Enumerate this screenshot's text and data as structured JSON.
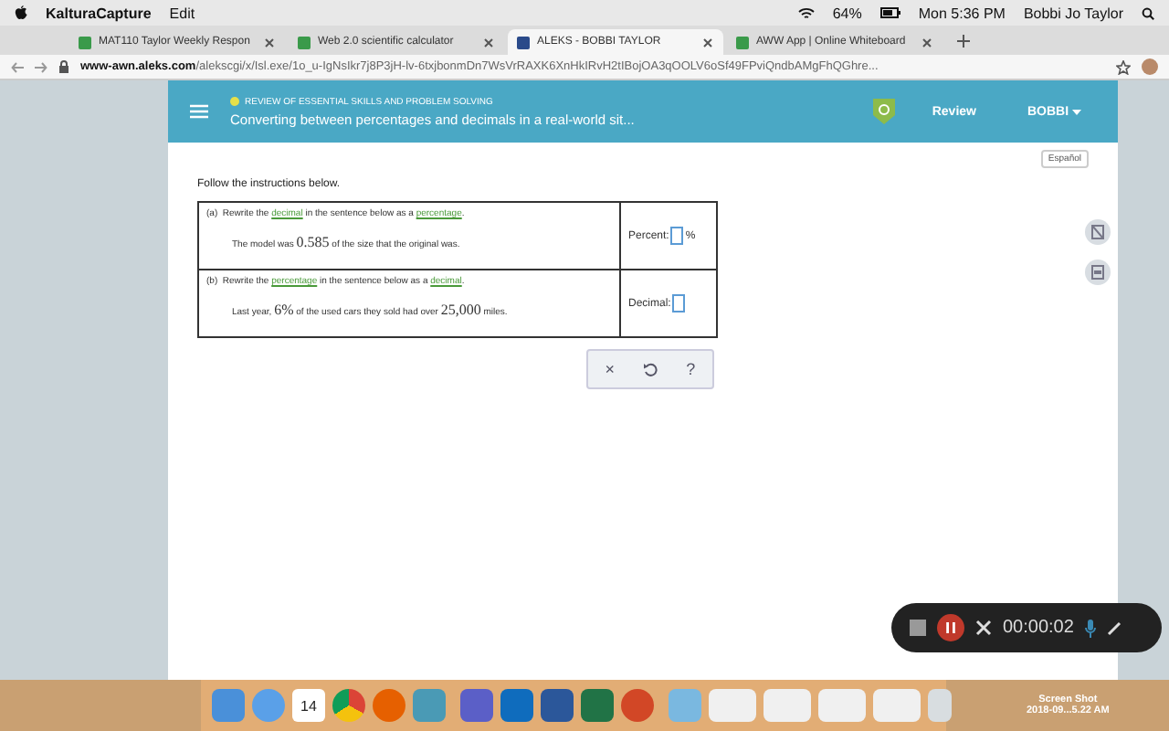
{
  "menubar": {
    "app": "KalturaCapture",
    "menus": [
      "Edit"
    ],
    "battery": "64%",
    "clock": "Mon 5:36 PM",
    "user": "Bobbi Jo Taylor"
  },
  "tabs": [
    {
      "label": "MAT110 Taylor Weekly Respon",
      "selected": false
    },
    {
      "label": "Web 2.0 scientific calculator",
      "selected": false
    },
    {
      "label": "ALEKS - BOBBI TAYLOR",
      "selected": true
    },
    {
      "label": "AWW App | Online Whiteboard",
      "selected": false
    }
  ],
  "address": {
    "domain": "www-awn.aleks.com",
    "path": "/alekscgi/x/Isl.exe/1o_u-IgNsIkr7j8P3jH-lv-6txjbonmDn7WsVrRAXK6XnHkIRvH2tIBojOA3qOOLV6oSf49FPviQndbAMgFhQGhre..."
  },
  "header": {
    "category": "REVIEW OF ESSENTIAL SKILLS AND PROBLEM SOLVING",
    "title": "Converting between percentages and decimals in a real-world sit...",
    "review": "Review",
    "user": "BOBBI"
  },
  "language": "Español",
  "instructions": "Follow the instructions below.",
  "rows": [
    {
      "label": "(a)",
      "instruction": [
        {
          "kind": "text",
          "text": "Rewrite the "
        },
        {
          "kind": "link",
          "text": "decimal"
        },
        {
          "kind": "text",
          "text": " in the sentence below as a "
        },
        {
          "kind": "link",
          "text": "percentage"
        },
        {
          "kind": "text",
          "text": "."
        }
      ],
      "sentence": [
        {
          "kind": "text",
          "text": "The model was "
        },
        {
          "kind": "math",
          "text": "0.585"
        },
        {
          "kind": "text",
          "text": " of the size that the original was."
        }
      ],
      "answer_label": "Percent:",
      "unit": "%"
    },
    {
      "label": "(b)",
      "instruction": [
        {
          "kind": "text",
          "text": "Rewrite the "
        },
        {
          "kind": "link",
          "text": "percentage"
        },
        {
          "kind": "text",
          "text": " in the sentence below as a "
        },
        {
          "kind": "link",
          "text": "decimal"
        },
        {
          "kind": "text",
          "text": "."
        }
      ],
      "sentence": [
        {
          "kind": "text",
          "text": "Last year, "
        },
        {
          "kind": "math",
          "text": "6%"
        },
        {
          "kind": "text",
          "text": " of the used cars they sold had over "
        },
        {
          "kind": "math",
          "text": "25,000"
        },
        {
          "kind": "text",
          "text": " miles."
        }
      ],
      "answer_label": "Decimal:"
    }
  ],
  "actions": {
    "clear": "×",
    "help": "?"
  },
  "recorder": {
    "timer": "00:00:02"
  },
  "dock": {
    "calendar_day": "14"
  },
  "desktop_file": {
    "name": "Screen Shot",
    "date": "2018-09...5.22 AM"
  }
}
